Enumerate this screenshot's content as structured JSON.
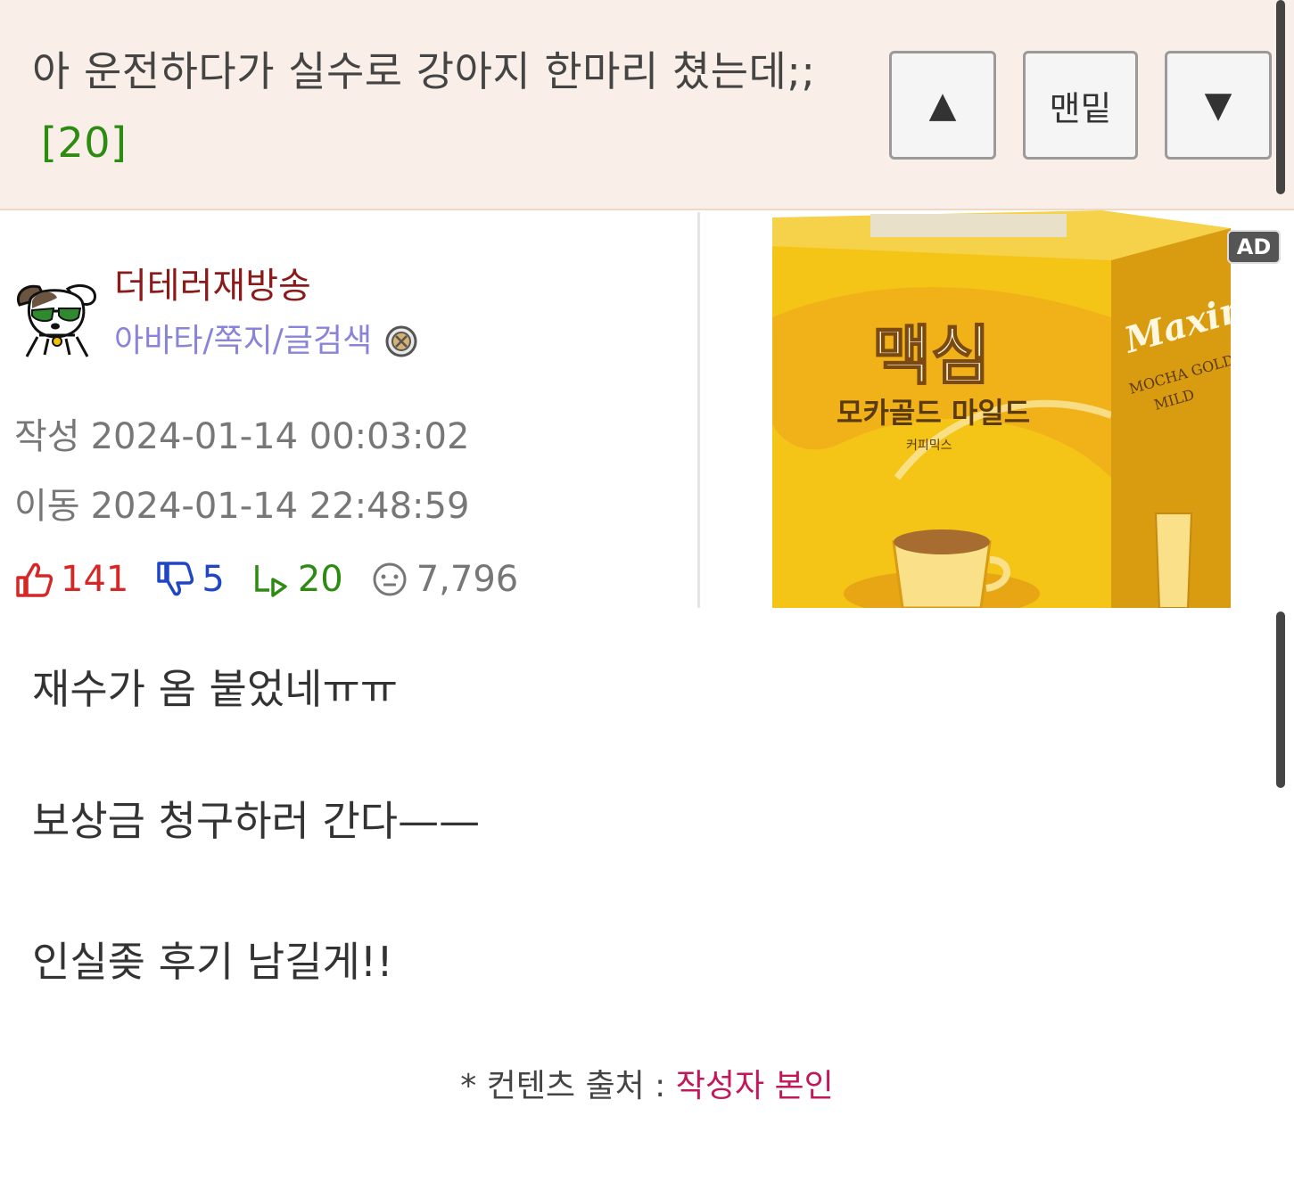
{
  "header": {
    "title": "아 운전하다가 실수로 강아지 한마리 쳤는데;;",
    "comment_count": "[20]",
    "btn_up": "▲",
    "btn_bottom": "맨밑",
    "btn_down": "▼"
  },
  "author": {
    "nickname": "더테러재방송",
    "links": "아바타/쪽지/글검색",
    "avatar_icon": "dog-avatar-icon",
    "badge_icon": "member-badge-icon"
  },
  "meta": {
    "created_label": "작성",
    "created": "2024-01-14 00:03:02",
    "moved_label": "이동",
    "moved": "2024-01-14 22:48:59"
  },
  "stats": {
    "upvotes": "141",
    "downvotes": "5",
    "replies": "20",
    "views": "7,796"
  },
  "ad": {
    "tag": "AD",
    "brand_ko": "맥심",
    "product_ko": "모카골드 마일드",
    "product_sub": "커피믹스",
    "brand_en": "Maxim",
    "product_en": "MOCHA GOLD",
    "variant_en": "MILD",
    "box_color": "#f4c417"
  },
  "body": {
    "line1": "재수가 옴 붙었네ㅠㅠ",
    "line2": "보상금 청구하러 간다——",
    "line3": "인실좆 후기 남길게!!"
  },
  "source": {
    "label": "* 컨텐츠 출처 : ",
    "value": "작성자 본인"
  }
}
